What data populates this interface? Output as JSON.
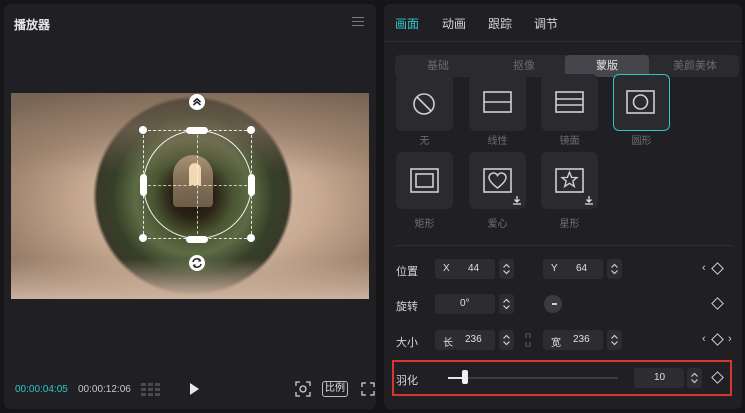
{
  "player": {
    "title": "播放器",
    "time_current": "00:00:04:05",
    "time_total": "00:00:12:06",
    "ratio_label": "比例"
  },
  "tabs": [
    {
      "label": "画面",
      "active": true
    },
    {
      "label": "动画",
      "active": false
    },
    {
      "label": "跟踪",
      "active": false
    },
    {
      "label": "调节",
      "active": false
    }
  ],
  "sub_tabs": [
    {
      "label": "基础",
      "active": false
    },
    {
      "label": "抠像",
      "active": false
    },
    {
      "label": "蒙版",
      "active": true
    },
    {
      "label": "美颜美体",
      "active": false
    }
  ],
  "masks": [
    {
      "label": "无",
      "icon": "no-mask-icon",
      "selected": false
    },
    {
      "label": "线性",
      "icon": "linear-mask-icon",
      "selected": false
    },
    {
      "label": "镜面",
      "icon": "mirror-mask-icon",
      "selected": false
    },
    {
      "label": "圆形",
      "icon": "circle-mask-icon",
      "selected": true
    },
    {
      "label": "矩形",
      "icon": "rectangle-mask-icon",
      "selected": false
    },
    {
      "label": "爱心",
      "icon": "heart-mask-icon",
      "selected": false,
      "download": true
    },
    {
      "label": "星形",
      "icon": "star-mask-icon",
      "selected": false,
      "download": true
    }
  ],
  "position": {
    "label": "位置",
    "x_prefix": "X",
    "x": "44",
    "y_prefix": "Y",
    "y": "64"
  },
  "rotation": {
    "label": "旋转",
    "value": "0°"
  },
  "size": {
    "label": "大小",
    "w_prefix": "长",
    "w": "236",
    "h_prefix": "宽",
    "h": "236"
  },
  "feather": {
    "label": "羽化",
    "value": "10",
    "level": 0.1
  },
  "colors": {
    "accent": "#2fc5c9",
    "highlight_box": "#d8352d"
  }
}
